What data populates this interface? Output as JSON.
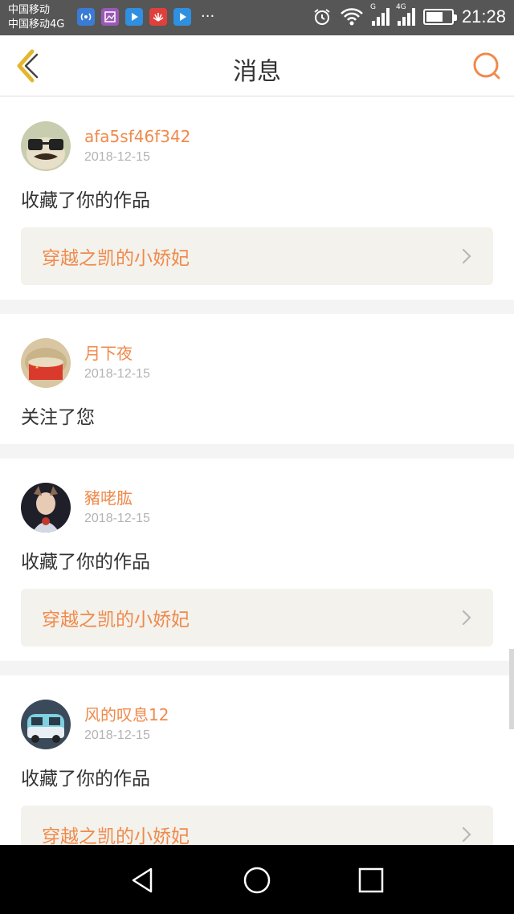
{
  "status_bar": {
    "carrier_1": "中国移动",
    "carrier_2": "中国移动4G",
    "signal_1_label": "G",
    "signal_2_label": "4G",
    "time": "21:28",
    "more_dots": "···"
  },
  "header": {
    "title": "消息"
  },
  "messages": [
    {
      "username": "afa5sf46f342",
      "date": "2018-12-15",
      "action": "收藏了你的作品",
      "work_title": "穿越之凯的小娇妃"
    },
    {
      "username": "月下夜",
      "date": "2018-12-15",
      "action": "关注了您"
    },
    {
      "username": "豬咾肱",
      "date": "2018-12-15",
      "action": "收藏了你的作品",
      "work_title": "穿越之凯的小娇妃"
    },
    {
      "username": "风的叹息12",
      "date": "2018-12-15",
      "action": "收藏了你的作品",
      "work_title": "穿越之凯的小娇妃"
    }
  ],
  "colors": {
    "accent": "#f08a4b",
    "back_icon": "#e3b72d",
    "work_bg": "#f3f2ed"
  }
}
